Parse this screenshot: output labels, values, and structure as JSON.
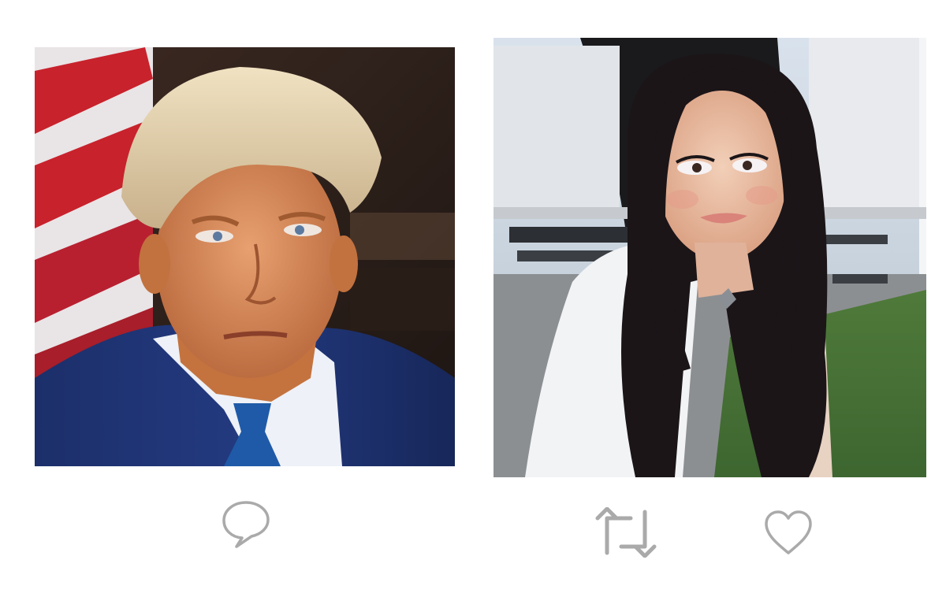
{
  "icons": {
    "reply": "speech-bubble-icon",
    "retweet": "retweet-arrows-icon",
    "like": "heart-outline-icon"
  },
  "colors": {
    "background": "#ffffff",
    "icon_stroke": "#aaaaaa"
  }
}
